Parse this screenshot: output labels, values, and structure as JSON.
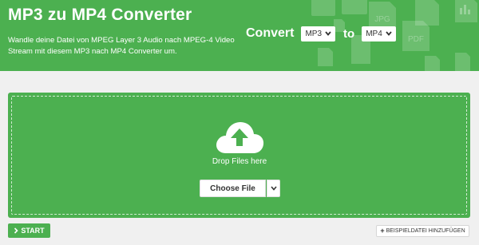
{
  "colors": {
    "brand_green": "#4cb050",
    "page_bg": "#f0f0f0",
    "text_white": "#ffffff"
  },
  "header": {
    "title": "MP3 zu MP4 Converter",
    "description": "Wandle deine Datei von MPEG Layer 3 Audio nach MPEG-4 Video Stream mit diesem MP3 nach MP4 Converter um.",
    "convert_label": "Convert",
    "from_format": "MP3",
    "to_label": "to",
    "to_format": "MP4",
    "bg_icons": [
      "mail-icon",
      "image-icon",
      "jpg-file-icon",
      "pdf-file-icon",
      "chart-file-icon",
      "document-icon"
    ],
    "bg_icon_labels": {
      "jpg": "JPG",
      "pdf": "PDF"
    }
  },
  "dropzone": {
    "icon": "cloud-upload-icon",
    "text": "Drop Files here",
    "choose_label": "Choose File"
  },
  "footer": {
    "start_label": "START",
    "sample_label": "BEISPIELDATEI HINZUFÜGEN"
  }
}
